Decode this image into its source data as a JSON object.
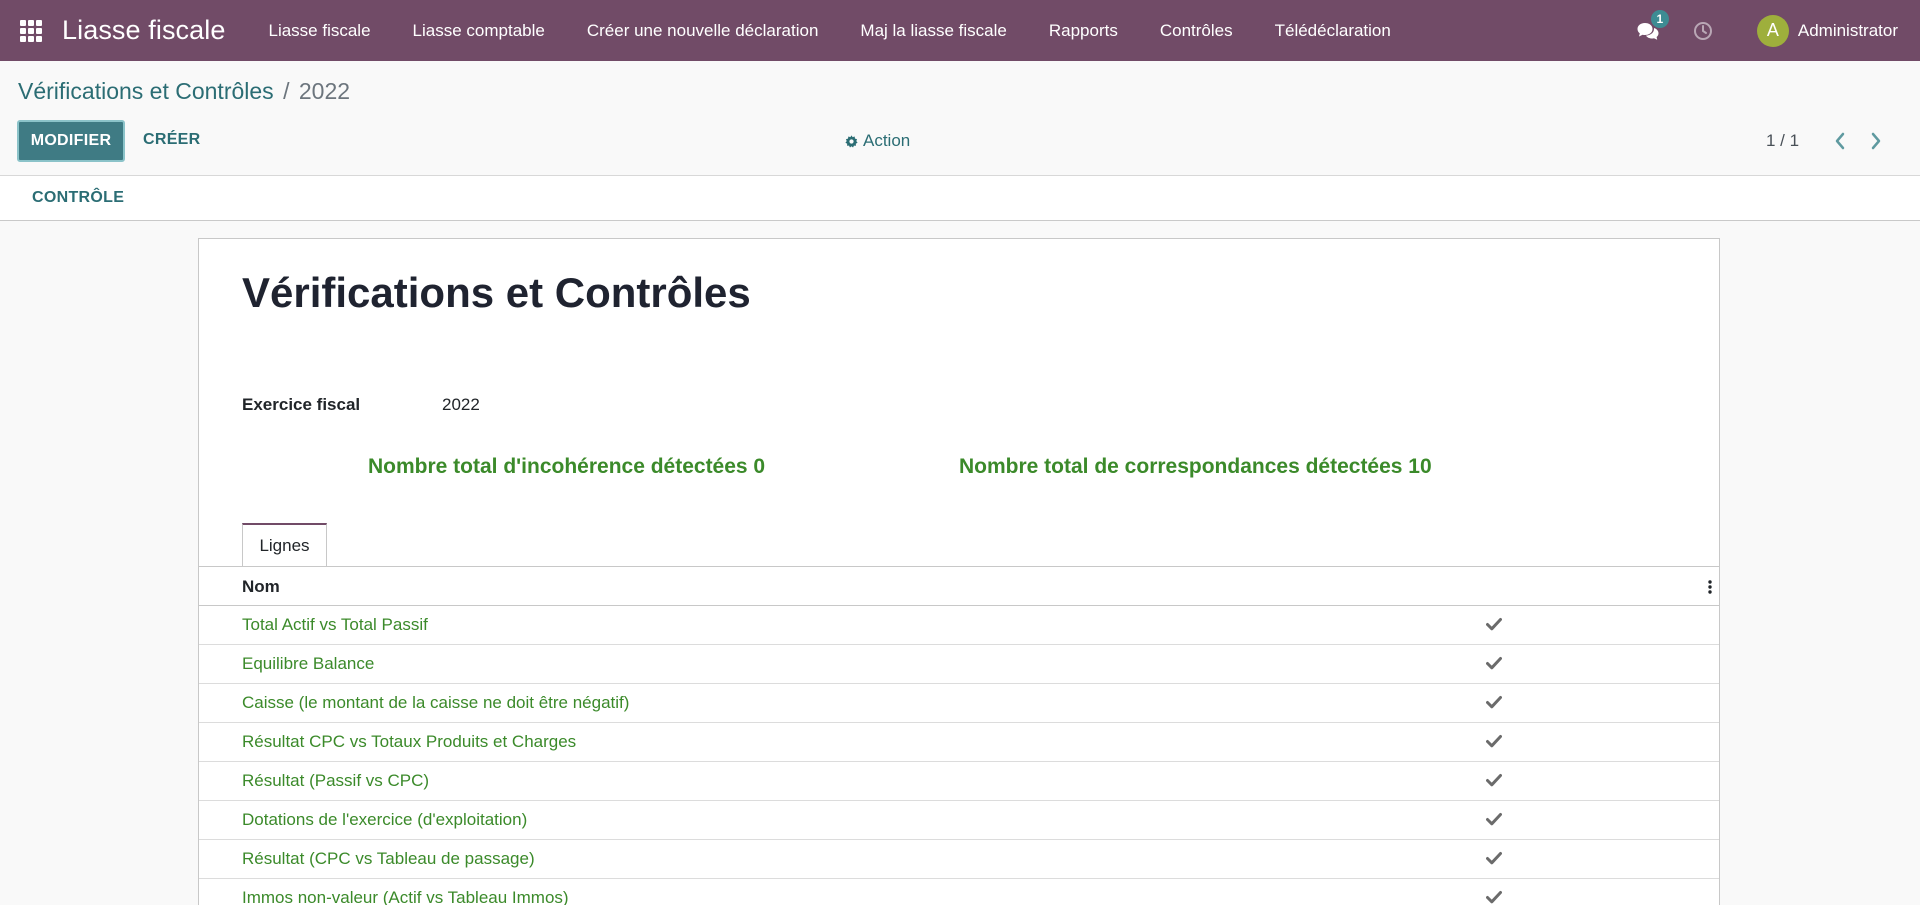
{
  "navbar": {
    "brand": "Liasse fiscale",
    "menu": [
      "Liasse fiscale",
      "Liasse comptable",
      "Créer une nouvelle déclaration",
      "Maj la liasse fiscale",
      "Rapports",
      "Contrôles",
      "Télédéclaration"
    ],
    "messages_count": "1",
    "avatar_initial": "A",
    "user": "Administrator",
    "color": "#714B67"
  },
  "breadcrumb": {
    "parent": "Vérifications et Contrôles",
    "separator": "/",
    "current": "2022"
  },
  "toolbar": {
    "edit_label": "MODIFIER",
    "create_label": "CRÉER",
    "action_label": "Action",
    "pager": "1 / 1"
  },
  "statusbar": {
    "control_label": "CONTRÔLE"
  },
  "form": {
    "title": "Vérifications et Contrôles",
    "fiscal_year_label": "Exercice fiscal",
    "fiscal_year_value": "2022",
    "inconsistencies": "Nombre total d'incohérence détectées 0",
    "matches": "Nombre total de correspondances détectées 10",
    "accent_color": "#3b8a2a"
  },
  "tabs": {
    "lines_label": "Lignes"
  },
  "list": {
    "column_name": "Nom",
    "rows": [
      "Total Actif vs Total Passif",
      "Equilibre Balance",
      "Caisse (le montant de la caisse ne doit être négatif)",
      "Résultat CPC vs Totaux Produits et Charges",
      "Résultat (Passif vs CPC)",
      "Dotations de l'exercice (d'exploitation)",
      "Résultat (CPC vs Tableau de passage)",
      "Immos non-valeur (Actif vs Tableau Immos)"
    ],
    "row_icon": "check-icon"
  }
}
